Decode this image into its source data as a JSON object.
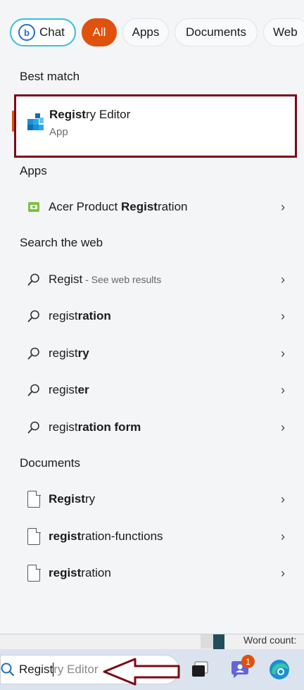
{
  "filters": {
    "chat": "Chat",
    "all": "All",
    "apps": "Apps",
    "documents": "Documents",
    "web": "Web"
  },
  "best_match": {
    "title": "Best match",
    "name_bold": "Regist",
    "name_rest": "ry Editor",
    "type": "App"
  },
  "apps": {
    "title": "Apps",
    "items": [
      {
        "pre": "Acer Product ",
        "bold": "Regist",
        "post": "ration"
      }
    ]
  },
  "web": {
    "title": "Search the web",
    "items": [
      {
        "pre": "Regist",
        "bold": "",
        "post": "",
        "hint": " - See web results"
      },
      {
        "pre": "regist",
        "bold": "ration",
        "post": "",
        "hint": ""
      },
      {
        "pre": "regist",
        "bold": "ry",
        "post": "",
        "hint": ""
      },
      {
        "pre": "regist",
        "bold": "er",
        "post": "",
        "hint": ""
      },
      {
        "pre": "regist",
        "bold": "ration form",
        "post": "",
        "hint": ""
      }
    ]
  },
  "documents": {
    "title": "Documents",
    "items": [
      {
        "bold": "Regist",
        "post": "ry"
      },
      {
        "bold": "regist",
        "post": "ration-functions"
      },
      {
        "bold": "regist",
        "post": "ration"
      }
    ]
  },
  "background": {
    "word_count": "Word count:"
  },
  "taskbar": {
    "search_typed": "Regist",
    "search_ghost": "ry Editor",
    "teams_badge": "1"
  },
  "colors": {
    "accent": "#e0510b",
    "highlight_border": "#7b0a19",
    "chat_border": "#36c2d8"
  }
}
